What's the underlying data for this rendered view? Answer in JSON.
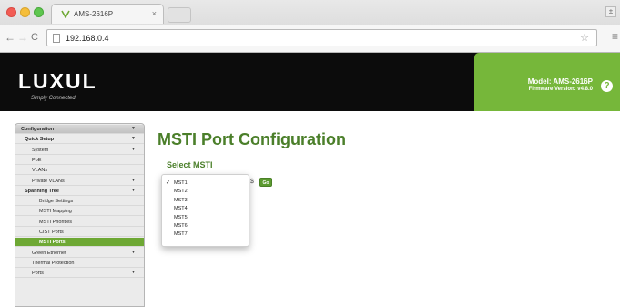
{
  "browser": {
    "tab_title": "AMS-2616P",
    "tab_close": "×",
    "url": "192.168.0.4",
    "back": "←",
    "forward": "→",
    "reload": "C",
    "star": "☆",
    "menu": "≡",
    "win_btn": "±"
  },
  "header": {
    "logo": "LUXUL",
    "tagline": "Simply Connected",
    "model": "Model: AMS-2616P",
    "firmware": "Firmware Version: v4.8.0",
    "help": "?"
  },
  "sidebar": {
    "items": [
      {
        "label": "Configuration",
        "level": 0,
        "arrow": "▼"
      },
      {
        "label": "Quick Setup",
        "level": 1,
        "arrow": "▼"
      },
      {
        "label": "System",
        "level": 2,
        "arrow": "▼"
      },
      {
        "label": "PoE",
        "level": 2,
        "arrow": ""
      },
      {
        "label": "VLANs",
        "level": 2,
        "arrow": ""
      },
      {
        "label": "Private VLANs",
        "level": 2,
        "arrow": "▼"
      },
      {
        "label": "Spanning Tree",
        "level": 1,
        "arrow": "▼"
      },
      {
        "label": "Bridge Settings",
        "level": 3,
        "arrow": ""
      },
      {
        "label": "MSTI Mapping",
        "level": 3,
        "arrow": ""
      },
      {
        "label": "MSTI Priorities",
        "level": 3,
        "arrow": ""
      },
      {
        "label": "CIST Ports",
        "level": 3,
        "arrow": ""
      },
      {
        "label": "MSTI Ports",
        "level": 3,
        "arrow": ""
      },
      {
        "label": "Green Ethernet",
        "level": 2,
        "arrow": "▼"
      },
      {
        "label": "Thermal Protection",
        "level": 2,
        "arrow": ""
      },
      {
        "label": "Ports",
        "level": 2,
        "arrow": "▼"
      }
    ]
  },
  "main": {
    "title": "MSTI Port Configuration",
    "select_label": "Select MSTI",
    "go_label": "Go",
    "dropdown_peek": "$",
    "selected_mark": "✓",
    "options": [
      "MST1",
      "MST2",
      "MST3",
      "MST4",
      "MST5",
      "MST6",
      "MST7"
    ],
    "selected": "MST1"
  },
  "colors": {
    "brand_green": "#76b73a",
    "title_green": "#4b7f2a",
    "active_item": "#6ea834"
  }
}
